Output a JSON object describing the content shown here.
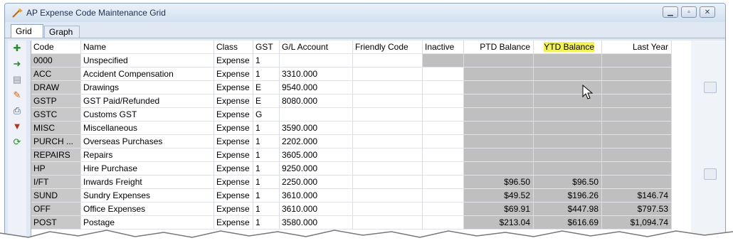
{
  "window": {
    "title": "AP Expense Code Maintenance Grid"
  },
  "tabs": {
    "grid": "Grid",
    "graph": "Graph"
  },
  "columns": [
    "Code",
    "Name",
    "Class",
    "GST",
    "G/L Account",
    "Friendly Code",
    "Inactive",
    "PTD Balance",
    "YTD Balance",
    "Last Year"
  ],
  "rows": [
    {
      "code": "0000",
      "name": "Unspecified",
      "class": "Expense",
      "gst": "1",
      "gl": "",
      "ptd": "",
      "ytd": "",
      "ly": ""
    },
    {
      "code": "ACC",
      "name": "Accident Compensation",
      "class": "Expense",
      "gst": "1",
      "gl": "3310.000",
      "ptd": "",
      "ytd": "",
      "ly": ""
    },
    {
      "code": "DRAW",
      "name": "Drawings",
      "class": "Expense",
      "gst": "E",
      "gl": "9540.000",
      "ptd": "",
      "ytd": "",
      "ly": ""
    },
    {
      "code": "GSTP",
      "name": "GST Paid/Refunded",
      "class": "Expense",
      "gst": "E",
      "gl": "8080.000",
      "ptd": "",
      "ytd": "",
      "ly": ""
    },
    {
      "code": "GSTC",
      "name": "Customs GST",
      "class": "Expense",
      "gst": "G",
      "gl": "",
      "ptd": "",
      "ytd": "",
      "ly": ""
    },
    {
      "code": "MISC",
      "name": "Miscellaneous",
      "class": "Expense",
      "gst": "1",
      "gl": "3590.000",
      "ptd": "",
      "ytd": "",
      "ly": ""
    },
    {
      "code": "PURCH ...",
      "name": "Overseas Purchases",
      "class": "Expense",
      "gst": "1",
      "gl": "2202.000",
      "ptd": "",
      "ytd": "",
      "ly": ""
    },
    {
      "code": "REPAIRS",
      "name": "Repairs",
      "class": "Expense",
      "gst": "1",
      "gl": "3605.000",
      "ptd": "",
      "ytd": "",
      "ly": ""
    },
    {
      "code": "HP",
      "name": "Hire Purchase",
      "class": "Expense",
      "gst": "1",
      "gl": "9250.000",
      "ptd": "",
      "ytd": "",
      "ly": ""
    },
    {
      "code": "I/FT",
      "name": "Inwards Freight",
      "class": "Expense",
      "gst": "1",
      "gl": "2250.000",
      "ptd": "$96.50",
      "ytd": "$96.50",
      "ly": ""
    },
    {
      "code": "SUND",
      "name": "Sundry Expenses",
      "class": "Expense",
      "gst": "1",
      "gl": "3610.000",
      "ptd": "$49.52",
      "ytd": "$196.26",
      "ly": "$146.74"
    },
    {
      "code": "OFF",
      "name": "Office Expenses",
      "class": "Expense",
      "gst": "1",
      "gl": "3610.000",
      "ptd": "$69.91",
      "ytd": "$447.98",
      "ly": "$797.53"
    },
    {
      "code": "POST",
      "name": "Postage",
      "class": "Expense",
      "gst": "1",
      "gl": "3580.000",
      "ptd": "$213.04",
      "ytd": "$616.69",
      "ly": "$1,094.74"
    }
  ],
  "colors": {
    "accent": "#dfe8f3",
    "grayCell": "#bfbfbf",
    "highlight": "#f4f25a"
  }
}
